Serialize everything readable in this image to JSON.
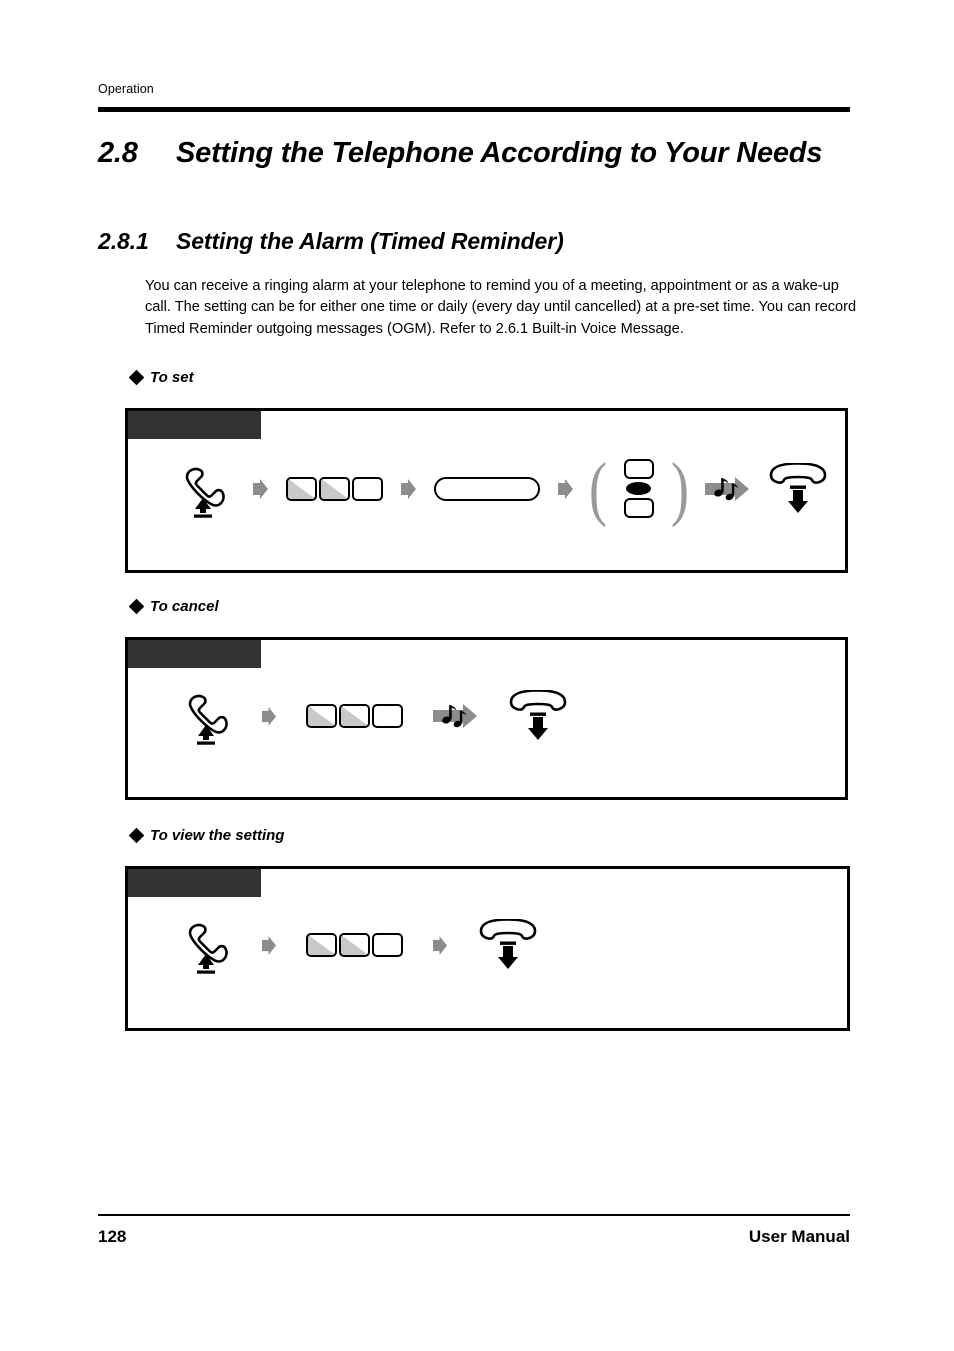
{
  "page": {
    "running_header": "Operation",
    "footer_page_number": "128",
    "footer_label": "User Manual"
  },
  "headings": {
    "section_number": "2.8",
    "section_title": "Setting the Telephone According to Your Needs",
    "subsection_number": "2.8.1",
    "subsection_title": "Setting the Alarm (Timed Reminder)"
  },
  "body": {
    "paragraph": "You can receive a ringing alarm at your telephone to remind you of a meeting, appointment or as a wake-up call. The setting can be for either one time or daily (every day until cancelled) at a pre-set time. You can record Timed Reminder outgoing messages (OGM). Refer to 2.6.1    Built-in Voice Message."
  },
  "procedures": [
    {
      "bullet_label": "To set",
      "header_bar_text": "",
      "steps": [
        {
          "icon": "off-hook-handset-icon"
        },
        {
          "icon": "arrow-right-icon"
        },
        {
          "icon": "dial-keys-icon",
          "keys": [
            "half",
            "half",
            "blank"
          ]
        },
        {
          "icon": "arrow-right-icon"
        },
        {
          "icon": "wide-key-icon"
        },
        {
          "icon": "arrow-right-icon"
        },
        {
          "icon": "option-group-icon",
          "options": [
            "key",
            "dot",
            "key"
          ]
        },
        {
          "icon": "ring-tone-icon"
        },
        {
          "icon": "on-hook-handset-icon"
        }
      ]
    },
    {
      "bullet_label": "To cancel",
      "header_bar_text": "",
      "steps": [
        {
          "icon": "off-hook-handset-icon"
        },
        {
          "icon": "arrow-right-icon"
        },
        {
          "icon": "dial-keys-icon",
          "keys": [
            "half",
            "half",
            "blank"
          ]
        },
        {
          "icon": "ring-tone-icon"
        },
        {
          "icon": "on-hook-handset-icon"
        }
      ]
    },
    {
      "bullet_label": "To view the setting",
      "header_bar_text": "",
      "steps": [
        {
          "icon": "off-hook-handset-icon"
        },
        {
          "icon": "arrow-right-icon"
        },
        {
          "icon": "dial-keys-icon",
          "keys": [
            "half",
            "half",
            "blank"
          ]
        },
        {
          "icon": "arrow-right-icon"
        },
        {
          "icon": "on-hook-handset-icon"
        }
      ]
    }
  ],
  "colors": {
    "header_bar": "#333333",
    "key_shade": "#c9c9c9",
    "arrow_gray": "#8c8c8c",
    "paren_gray": "#9a9a9a"
  }
}
